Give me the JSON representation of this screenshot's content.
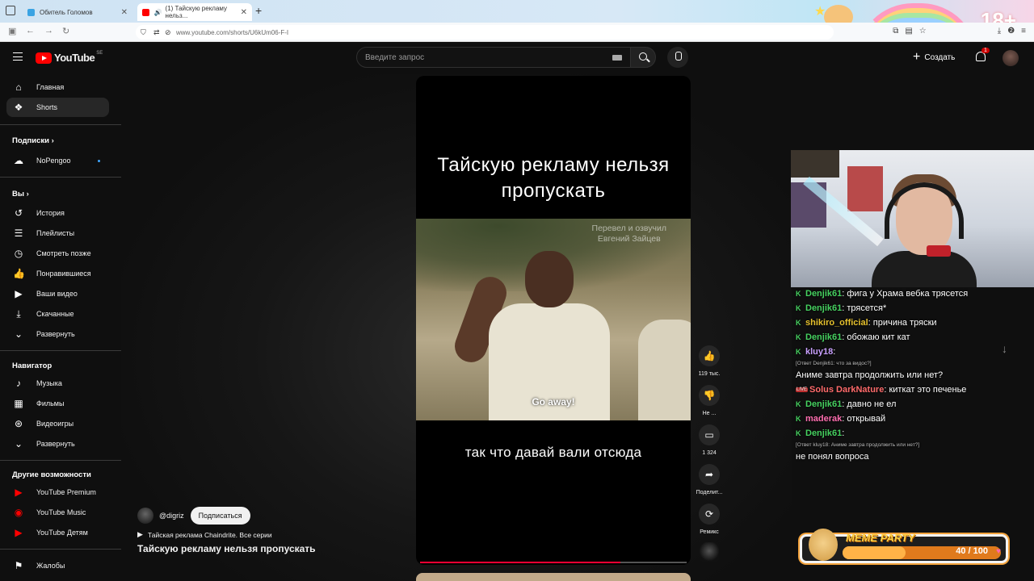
{
  "browser": {
    "tabs": [
      {
        "title": "Обитель Голомов",
        "favicon_color": "#3aa3e3"
      },
      {
        "title": "(1) Тайскую рекламу нельз...",
        "favicon_color": "#ff0000",
        "active": true
      }
    ],
    "url": "www.youtube.com/shorts/U6kUm06-F-I",
    "decoration_number": "18+"
  },
  "header": {
    "logo": "YouTube",
    "region": "SE",
    "search_placeholder": "Введите запрос",
    "create_label": "Создать",
    "notification_count": "1"
  },
  "sidebar": {
    "main": [
      {
        "label": "Главная",
        "icon": "home-icon"
      },
      {
        "label": "Shorts",
        "icon": "shorts-icon",
        "active": true
      }
    ],
    "subscriptions_heading": "Подписки",
    "subscriptions": [
      {
        "label": "NoPengoo",
        "icon": "channel-avatar"
      }
    ],
    "you_heading": "Вы",
    "you": [
      {
        "label": "История",
        "icon": "history-icon"
      },
      {
        "label": "Плейлисты",
        "icon": "playlists-icon"
      },
      {
        "label": "Смотреть позже",
        "icon": "watch-later-icon"
      },
      {
        "label": "Понравившиеся",
        "icon": "like-icon"
      },
      {
        "label": "Ваши видео",
        "icon": "your-videos-icon"
      },
      {
        "label": "Скачанные",
        "icon": "download-icon"
      },
      {
        "label": "Развернуть",
        "icon": "chevron-down-icon"
      }
    ],
    "navigator_heading": "Навигатор",
    "navigator": [
      {
        "label": "Музыка",
        "icon": "music-icon"
      },
      {
        "label": "Фильмы",
        "icon": "film-icon"
      },
      {
        "label": "Видеоигры",
        "icon": "gaming-icon"
      },
      {
        "label": "Развернуть",
        "icon": "chevron-down-icon"
      }
    ],
    "more_heading": "Другие возможности",
    "more": [
      {
        "label": "YouTube Premium",
        "icon": "yt-premium-icon"
      },
      {
        "label": "YouTube Music",
        "icon": "yt-music-icon"
      },
      {
        "label": "YouTube Детям",
        "icon": "yt-kids-icon"
      }
    ],
    "report": {
      "label": "Жалобы",
      "icon": "flag-icon"
    }
  },
  "short": {
    "overlay_title": "Тайскую рекламу нельзя пропускать",
    "clip_credit_line1": "Перевел и озвучил",
    "clip_credit_line2": "Евгений Зайцев",
    "clip_subtitle": "Go away!",
    "caption": "так что давай вали отсюда",
    "progress": 0.75,
    "channel": "@digriz",
    "subscribe_label": "Подписаться",
    "playlist": "Тайская реклама Chaindrite. Все серии",
    "title": "Тайскую рекламу нельзя пропускать"
  },
  "actions": {
    "like_count": "119 тыс.",
    "dislike_label": "Не ...",
    "comment_count": "1 324",
    "share_label": "Поделит...",
    "remix_label": "Ремикс"
  },
  "chat": [
    {
      "user": "Denjik61",
      "user_color": "#46d160",
      "text": "фига у Храма вебка трясется",
      "badge": "K"
    },
    {
      "user": "Denjik61",
      "user_color": "#46d160",
      "text": "трясется*",
      "badge": "K"
    },
    {
      "user": "shikiro_official",
      "user_color": "#e6c12e",
      "text": "причина тряски",
      "badge": "K"
    },
    {
      "user": "Denjik61",
      "user_color": "#46d160",
      "text": "обожаю кит кат",
      "badge": "K"
    },
    {
      "user": "kluy18",
      "user_color": "#c9a0ff",
      "text": "",
      "badge": "K",
      "reply": "[Ответ Denjik61: что за видос?]"
    },
    {
      "user": "",
      "user_color": "#ffffff",
      "text": "Аниме завтра продолжить или нет?",
      "badge": ""
    },
    {
      "user": "Solus DarkNature",
      "user_color": "#ff6b6b",
      "text": "киткат это печенье",
      "badge": "LIVE"
    },
    {
      "user": "Denjik61",
      "user_color": "#46d160",
      "text": "давно не ел",
      "badge": "K"
    },
    {
      "user": "maderak",
      "user_color": "#ff6fb0",
      "text": "открывай",
      "badge": "K"
    },
    {
      "user": "Denjik61",
      "user_color": "#46d160",
      "text": "",
      "badge": "K",
      "reply": "[Ответ kluy18: Аниме завтра продолжить или нет?]"
    },
    {
      "user": "",
      "user_color": "#ffffff",
      "text": "не понял вопроса",
      "badge": ""
    }
  ],
  "meme_party": {
    "brand": "MEME PARTY",
    "counter": "40 / 100",
    "fill": 0.4
  }
}
